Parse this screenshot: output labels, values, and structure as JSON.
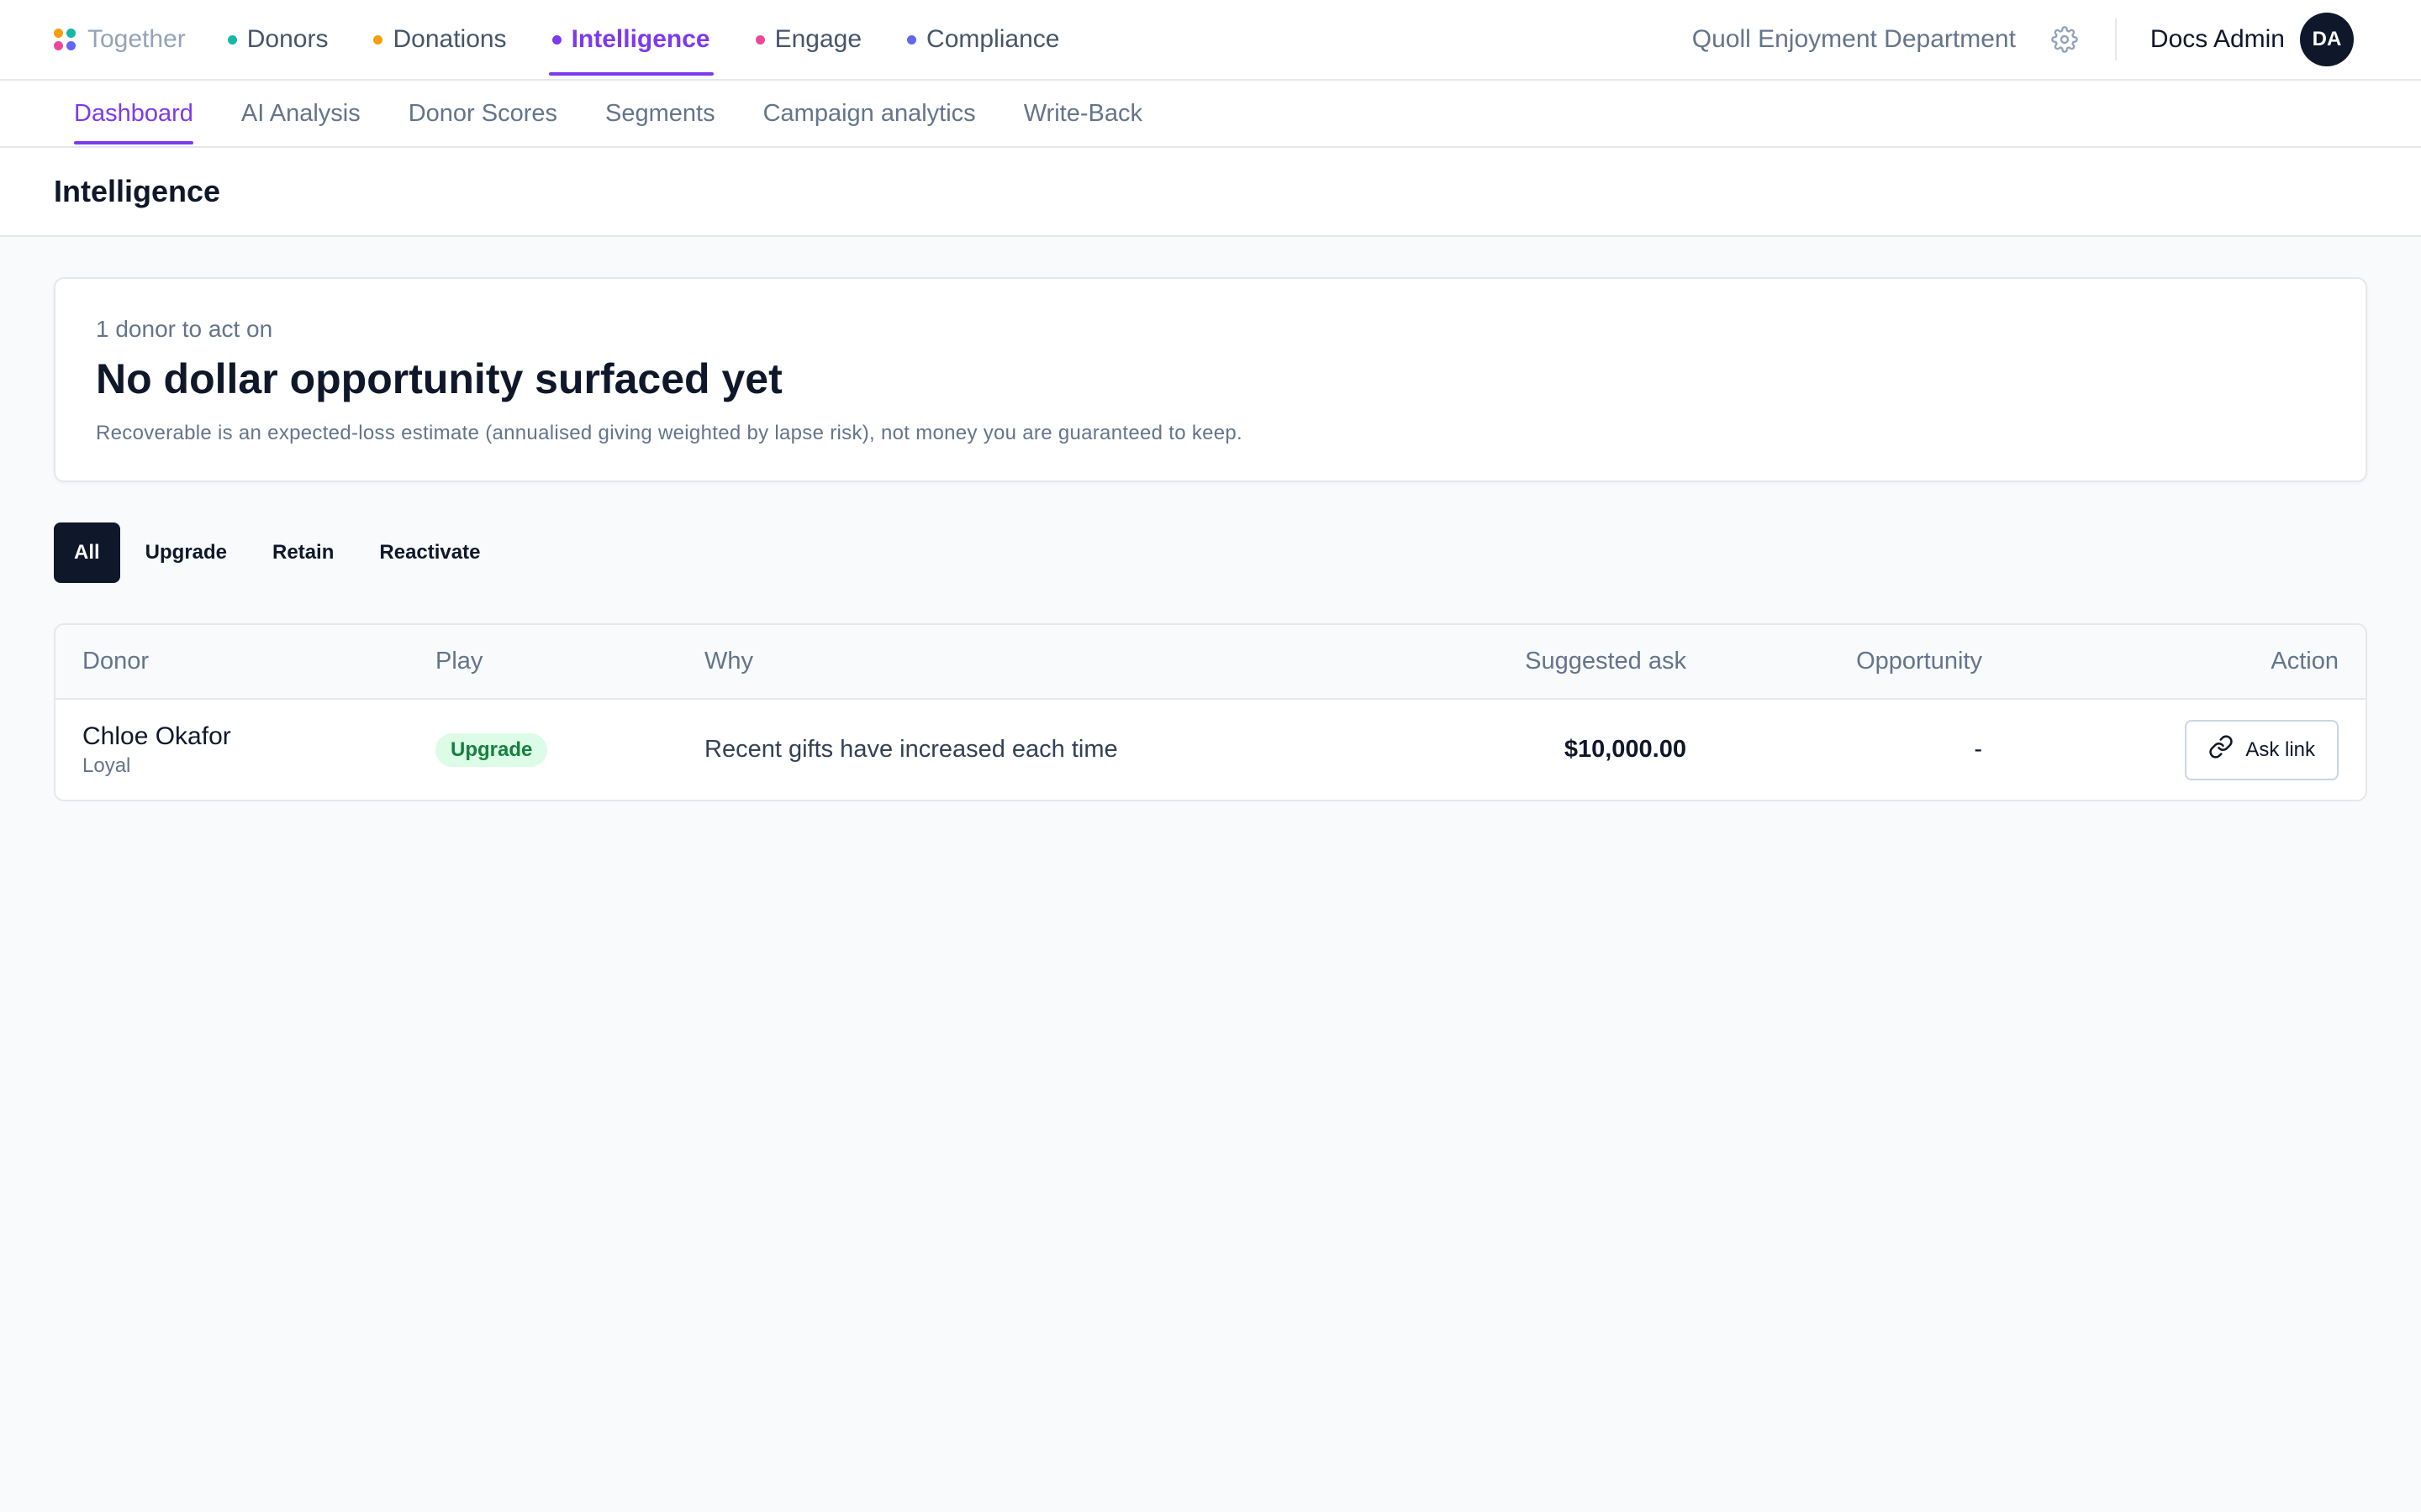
{
  "brand": {
    "name": "Together",
    "logo_colors": [
      "#f59e0b",
      "#14b8a6",
      "#ec4899",
      "#6366f1"
    ]
  },
  "main_nav": [
    {
      "label": "Donors",
      "dot_color": "#14b8a6",
      "active": false
    },
    {
      "label": "Donations",
      "dot_color": "#f59e0b",
      "active": false
    },
    {
      "label": "Intelligence",
      "dot_color": "#7c3aed",
      "active": true
    },
    {
      "label": "Engage",
      "dot_color": "#ec4899",
      "active": false
    },
    {
      "label": "Compliance",
      "dot_color": "#6366f1",
      "active": false
    }
  ],
  "header_right": {
    "org_name": "Quoll Enjoyment Department",
    "settings_icon": "gear-icon",
    "user_name": "Docs Admin",
    "avatar_initials": "DA"
  },
  "sub_nav": [
    {
      "label": "Dashboard",
      "active": true
    },
    {
      "label": "AI Analysis",
      "active": false
    },
    {
      "label": "Donor Scores",
      "active": false
    },
    {
      "label": "Segments",
      "active": false
    },
    {
      "label": "Campaign analytics",
      "active": false
    },
    {
      "label": "Write-Back",
      "active": false
    }
  ],
  "page": {
    "title": "Intelligence"
  },
  "summary": {
    "eyebrow": "1 donor to act on",
    "headline": "No dollar opportunity surfaced yet",
    "note": "Recoverable is an expected-loss estimate (annualised giving weighted by lapse risk), not money you are guaranteed to keep."
  },
  "filters": [
    {
      "label": "All",
      "active": true
    },
    {
      "label": "Upgrade",
      "active": false
    },
    {
      "label": "Retain",
      "active": false
    },
    {
      "label": "Reactivate",
      "active": false
    }
  ],
  "table": {
    "columns": [
      "Donor",
      "Play",
      "Why",
      "Suggested ask",
      "Opportunity",
      "Action"
    ],
    "rows": [
      {
        "donor_name": "Chloe Okafor",
        "donor_tier": "Loyal",
        "play": "Upgrade",
        "why": "Recent gifts have increased each time",
        "suggested_ask": "$10,000.00",
        "opportunity": "-",
        "action_label": "Ask link",
        "action_icon": "link-icon"
      }
    ]
  },
  "colors": {
    "accent": "#7c3aed",
    "dark": "#0f172a",
    "badge_bg": "#dcfce7",
    "badge_text": "#15803d"
  }
}
